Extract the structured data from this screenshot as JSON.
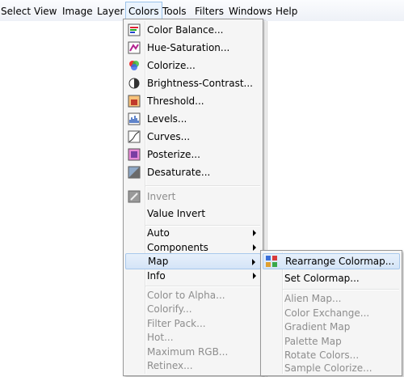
{
  "menubar": {
    "items": [
      "Select",
      "View",
      "Image",
      "Layer",
      "Colors",
      "Tools",
      "Filters",
      "Windows",
      "Help"
    ]
  },
  "colors_menu": {
    "items": [
      {
        "label": "Color Balance...",
        "icon": "color-balance-icon",
        "enabled": true
      },
      {
        "label": "Hue-Saturation...",
        "icon": "hue-saturation-icon",
        "enabled": true
      },
      {
        "label": "Colorize...",
        "icon": "colorize-icon",
        "enabled": true
      },
      {
        "label": "Brightness-Contrast...",
        "icon": "brightness-contrast-icon",
        "enabled": true
      },
      {
        "label": "Threshold...",
        "icon": "threshold-icon",
        "enabled": true
      },
      {
        "label": "Levels...",
        "icon": "levels-icon",
        "enabled": true
      },
      {
        "label": "Curves...",
        "icon": "curves-icon",
        "enabled": true
      },
      {
        "label": "Posterize...",
        "icon": "posterize-icon",
        "enabled": true
      },
      {
        "label": "Desaturate...",
        "icon": "desaturate-icon",
        "enabled": true
      },
      {
        "label": "Invert",
        "icon": "invert-icon",
        "enabled": false
      },
      {
        "label": "Value Invert",
        "enabled": true
      },
      {
        "label": "Auto",
        "enabled": true,
        "submenu": true
      },
      {
        "label": "Components",
        "enabled": true,
        "submenu": true
      },
      {
        "label": "Map",
        "enabled": true,
        "submenu": true,
        "highlighted": true
      },
      {
        "label": "Info",
        "enabled": true,
        "submenu": true
      },
      {
        "label": "Color to Alpha...",
        "enabled": false
      },
      {
        "label": "Colorify...",
        "enabled": false
      },
      {
        "label": "Filter Pack...",
        "enabled": false
      },
      {
        "label": "Hot...",
        "enabled": false
      },
      {
        "label": "Maximum RGB...",
        "enabled": false
      },
      {
        "label": "Retinex...",
        "enabled": false
      }
    ]
  },
  "map_submenu": {
    "items": [
      {
        "label": "Rearrange Colormap...",
        "icon": "rearrange-colormap-icon",
        "enabled": true,
        "highlighted": true
      },
      {
        "label": "Set Colormap...",
        "enabled": true
      },
      {
        "label": "Alien Map...",
        "enabled": false
      },
      {
        "label": "Color Exchange...",
        "enabled": false
      },
      {
        "label": "Gradient Map",
        "enabled": false
      },
      {
        "label": "Palette Map",
        "enabled": false
      },
      {
        "label": "Rotate Colors...",
        "enabled": false
      },
      {
        "label": "Sample Colorize...",
        "enabled": false
      }
    ]
  }
}
